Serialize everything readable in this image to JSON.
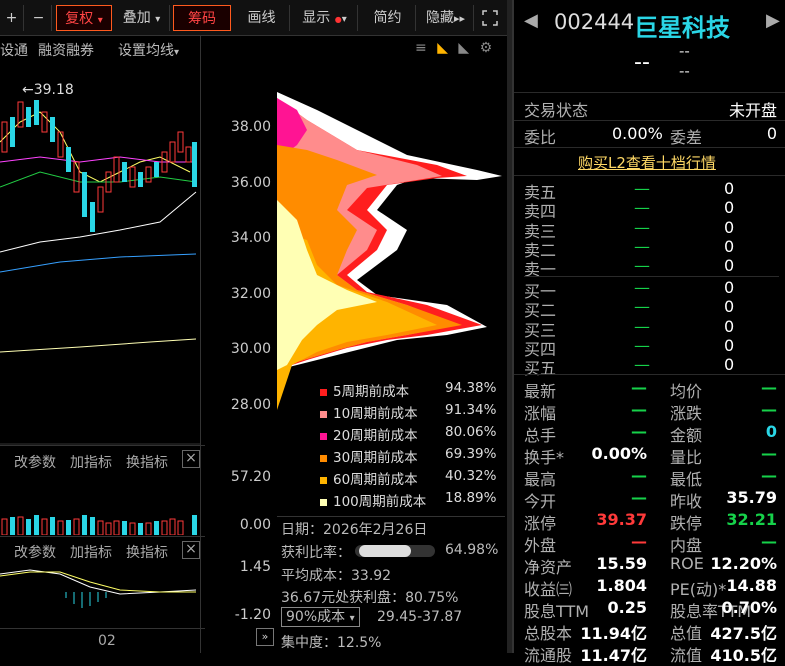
{
  "toolbar": {
    "plus": "+",
    "minus": "−",
    "fuquan": "复权",
    "diejia": "叠加",
    "chouma": "筹码",
    "huaxian": "画线",
    "xianshi": "显示",
    "jianyue": "简约",
    "yincang": "隐藏",
    "expand_icon": "expand-icon"
  },
  "subbar": {
    "left": "设通",
    "rzrq": "融资融券",
    "junxian": "设置均线"
  },
  "chart": {
    "high_label": "←39.18",
    "x_label": "02"
  },
  "price_axis": [
    "38.00",
    "36.00",
    "34.00",
    "32.00",
    "30.00",
    "28.00"
  ],
  "vol_axis": [
    "57.20",
    "0.00"
  ],
  "macd_axis": [
    "1.45",
    "-1.20"
  ],
  "indicator_tabs": {
    "vol": [
      "改参数",
      "加指标",
      "换指标"
    ],
    "macd": [
      "改参数",
      "加指标",
      "换指标"
    ]
  },
  "chip_legend": [
    {
      "label": "5周期前成本",
      "pct": "94.38%",
      "color": "#ff1e1e"
    },
    {
      "label": "10周期前成本",
      "pct": "91.34%",
      "color": "#ff8c8c"
    },
    {
      "label": "20周期前成本",
      "pct": "80.06%",
      "color": "#ff1493"
    },
    {
      "label": "30周期前成本",
      "pct": "69.39%",
      "color": "#ff8c00"
    },
    {
      "label": "60周期前成本",
      "pct": "40.32%",
      "color": "#ffb400"
    },
    {
      "label": "100周期前成本",
      "pct": "18.89%",
      "color": "#ffffb4"
    }
  ],
  "chip_info": {
    "date": "日期：2026年2月26日",
    "profit_ratio_label": "获利比率：",
    "profit_ratio": "64.98%",
    "profit_ratio_fill": 0.6498,
    "avg_cost": "平均成本：33.92",
    "profit_at": "36.67元处获利盘：80.75%",
    "cost_select": "90%成本",
    "cost_range": "29.45-37.87",
    "concentration": "集中度：12.5%"
  },
  "quote": {
    "code": "002444",
    "name": "巨星科技",
    "price": "--",
    "change1": "--",
    "change2": "--",
    "status_label": "交易状态",
    "status_value": "未开盘",
    "weibi_label": "委比",
    "weibi_value": "0.00%",
    "weicha_label": "委差",
    "weicha_value": "0",
    "l2_link": "购买L2查看十档行情",
    "sells": [
      {
        "label": "卖五",
        "price": "—",
        "vol": "0"
      },
      {
        "label": "卖四",
        "price": "—",
        "vol": "0"
      },
      {
        "label": "卖三",
        "price": "—",
        "vol": "0"
      },
      {
        "label": "卖二",
        "price": "—",
        "vol": "0"
      },
      {
        "label": "卖一",
        "price": "—",
        "vol": "0"
      }
    ],
    "buys": [
      {
        "label": "买一",
        "price": "—",
        "vol": "0"
      },
      {
        "label": "买二",
        "price": "—",
        "vol": "0"
      },
      {
        "label": "买三",
        "price": "—",
        "vol": "0"
      },
      {
        "label": "买四",
        "price": "—",
        "vol": "0"
      },
      {
        "label": "买五",
        "price": "—",
        "vol": "0"
      }
    ],
    "stats": [
      [
        "最新",
        "—",
        "均价",
        "—"
      ],
      [
        "涨幅",
        "—",
        "涨跌",
        "—"
      ],
      [
        "总手",
        "—",
        "金额",
        "0"
      ],
      [
        "换手*",
        "0.00%",
        "量比",
        "—"
      ],
      [
        "最高",
        "—",
        "最低",
        "—"
      ],
      [
        "今开",
        "—",
        "昨收",
        "35.79"
      ],
      [
        "涨停",
        "39.37",
        "跌停",
        "32.21"
      ],
      [
        "外盘",
        "—",
        "内盘",
        "—"
      ],
      [
        "净资产",
        "15.59",
        "ROE",
        "12.20%"
      ],
      [
        "收益㈢",
        "1.804",
        "PE(动)*",
        "14.88"
      ],
      [
        "股息TTM",
        "0.25",
        "股息率TTM",
        "0.70%"
      ],
      [
        "总股本",
        "11.94亿",
        "总值",
        "427.5亿"
      ],
      [
        "流通股",
        "11.47亿",
        "流值",
        "410.5亿"
      ]
    ]
  }
}
